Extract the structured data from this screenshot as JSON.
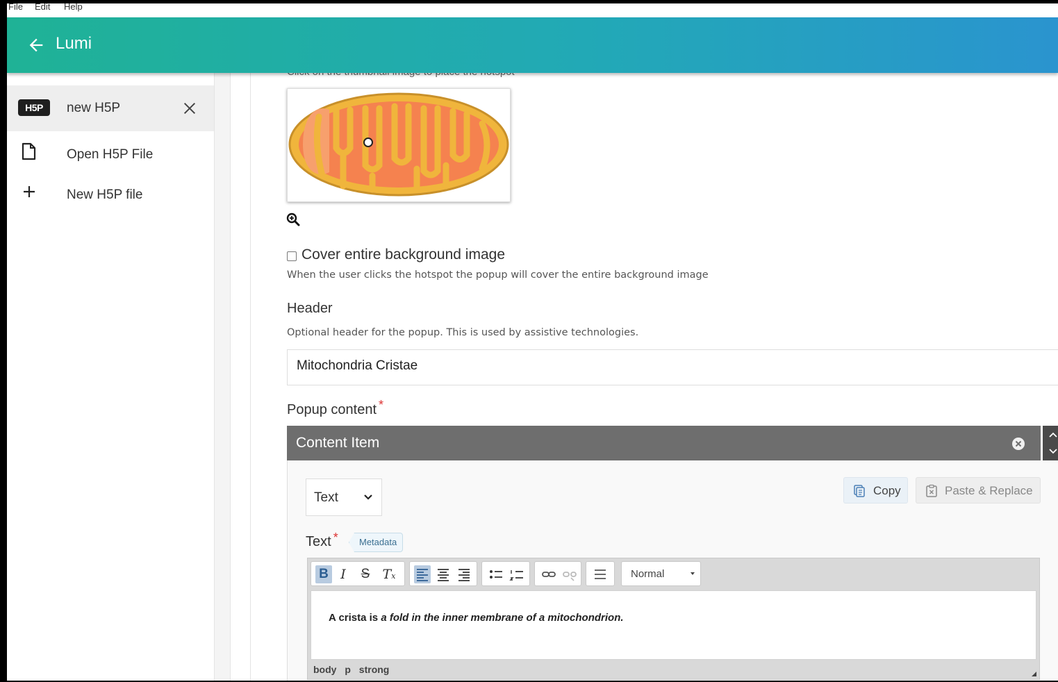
{
  "menu": {
    "file": "File",
    "edit": "Edit",
    "help": "Help"
  },
  "app": {
    "title": "Lumi",
    "accent_start": "#1fb296",
    "accent_end": "#2a94cf"
  },
  "sidebar": {
    "current_file": {
      "badge": "H5P",
      "label": "new H5P"
    },
    "items": [
      {
        "label": "Open H5P File",
        "icon": "file-icon"
      },
      {
        "label": "New H5P file",
        "icon": "plus-icon"
      }
    ]
  },
  "editor": {
    "hotspot_hint": "Click on the thumbnail image to place the hotspot",
    "cover": {
      "label": "Cover entire background image",
      "description": "When the user clicks the hotspot the popup will cover the entire background image",
      "checked": false
    },
    "header": {
      "label": "Header",
      "description": "Optional header for the popup. This is used by assistive technologies.",
      "value": "Mitochondria Cristae"
    },
    "popup": {
      "label": "Popup content",
      "required_mark": "*",
      "content_item_title": "Content Item",
      "type_value": "Text",
      "copy_label": "Copy",
      "paste_label": "Paste & Replace",
      "text_label": "Text",
      "metadata_label": "Metadata",
      "format_value": "Normal",
      "body_plain": "A crista is",
      "body_italic": "a fold in the inner membrane of a mitochondrion.",
      "path": [
        "body",
        "p",
        "strong"
      ]
    }
  }
}
